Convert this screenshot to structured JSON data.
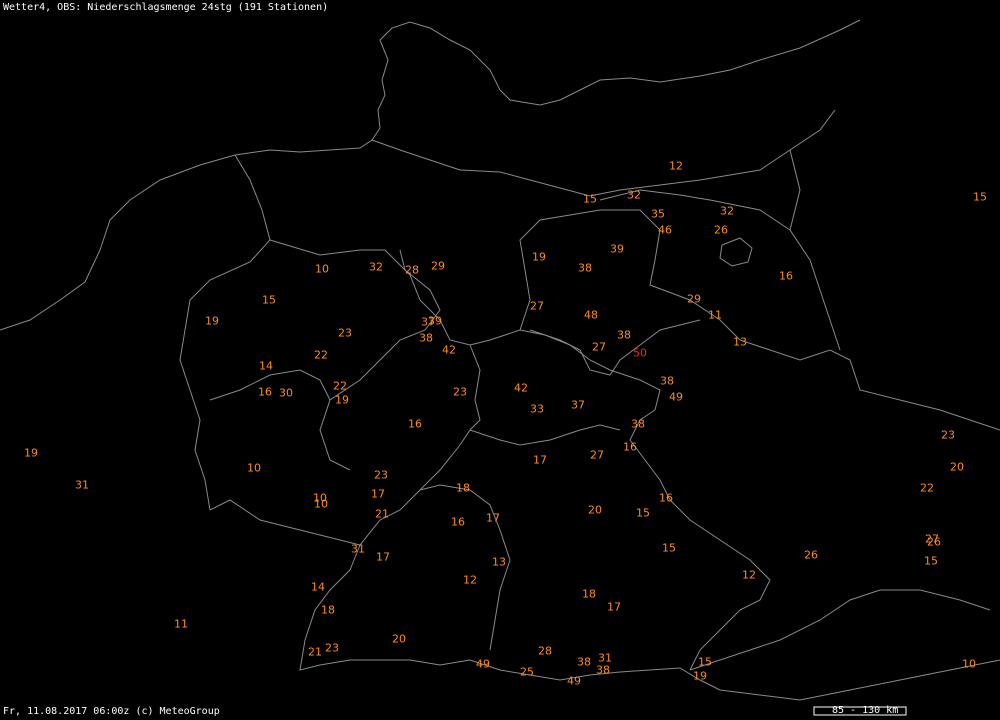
{
  "title": "Wetter4, OBS: Niederschlagsmenge 24stg (191 Stationen)",
  "footer": "Fr, 11.08.2017 06:00z (c) MeteoGroup",
  "scale_label": "85 - 130 km",
  "colors": {
    "value": "#ff8c1a",
    "max_value": "#ff2020",
    "border": "#8a8a8a",
    "text": "#ffffff",
    "background": "#000000"
  },
  "stations": [
    {
      "v": "12"
    },
    {
      "v": "15"
    },
    {
      "v": "32"
    },
    {
      "v": "35"
    },
    {
      "v": "32"
    },
    {
      "v": "15"
    },
    {
      "v": "46"
    },
    {
      "v": "26"
    },
    {
      "v": "39"
    },
    {
      "v": "19"
    },
    {
      "v": "38"
    },
    {
      "v": "16"
    },
    {
      "v": "10"
    },
    {
      "v": "32"
    },
    {
      "v": "28"
    },
    {
      "v": "29"
    },
    {
      "v": "15"
    },
    {
      "v": "19"
    },
    {
      "v": "29"
    },
    {
      "v": "27"
    },
    {
      "v": "48"
    },
    {
      "v": "11"
    },
    {
      "v": "23"
    },
    {
      "v": "37"
    },
    {
      "v": "39"
    },
    {
      "v": "38"
    },
    {
      "v": "38"
    },
    {
      "v": "13"
    },
    {
      "v": "22"
    },
    {
      "v": "42"
    },
    {
      "v": "27"
    },
    {
      "v": "50",
      "max": true
    },
    {
      "v": "14"
    },
    {
      "v": "38"
    },
    {
      "v": "16"
    },
    {
      "v": "30"
    },
    {
      "v": "22"
    },
    {
      "v": "19"
    },
    {
      "v": "23"
    },
    {
      "v": "42"
    },
    {
      "v": "49"
    },
    {
      "v": "33"
    },
    {
      "v": "37"
    },
    {
      "v": "16"
    },
    {
      "v": "38"
    },
    {
      "v": "23"
    },
    {
      "v": "19"
    },
    {
      "v": "16"
    },
    {
      "v": "17"
    },
    {
      "v": "27"
    },
    {
      "v": "20"
    },
    {
      "v": "31"
    },
    {
      "v": "10"
    },
    {
      "v": "23"
    },
    {
      "v": "22"
    },
    {
      "v": "18"
    },
    {
      "v": "16"
    },
    {
      "v": "10"
    },
    {
      "v": "17"
    },
    {
      "v": "10"
    },
    {
      "v": "21"
    },
    {
      "v": "16"
    },
    {
      "v": "17"
    },
    {
      "v": "20"
    },
    {
      "v": "15"
    },
    {
      "v": "27"
    },
    {
      "v": "26"
    },
    {
      "v": "31"
    },
    {
      "v": "17"
    },
    {
      "v": "15"
    },
    {
      "v": "26"
    },
    {
      "v": "15"
    },
    {
      "v": "13"
    },
    {
      "v": "12"
    },
    {
      "v": "12"
    },
    {
      "v": "14"
    },
    {
      "v": "18"
    },
    {
      "v": "17"
    },
    {
      "v": "18"
    },
    {
      "v": "11"
    },
    {
      "v": "20"
    },
    {
      "v": "23"
    },
    {
      "v": "21"
    },
    {
      "v": "28"
    },
    {
      "v": "38"
    },
    {
      "v": "31"
    },
    {
      "v": "38"
    },
    {
      "v": "15"
    },
    {
      "v": "49"
    },
    {
      "v": "25"
    },
    {
      "v": "49"
    },
    {
      "v": "19"
    },
    {
      "v": "10"
    }
  ]
}
